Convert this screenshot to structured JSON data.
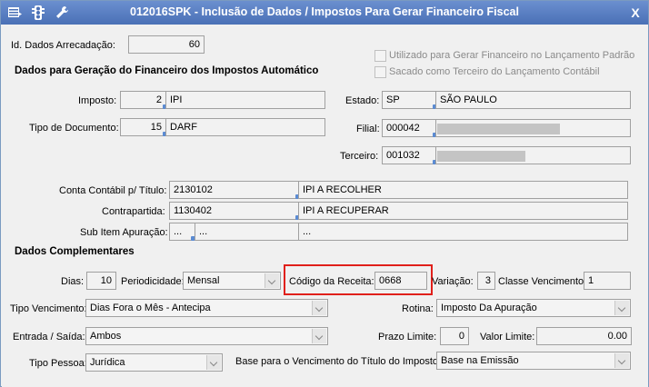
{
  "window": {
    "title": "012016SPK - Inclusão de Dados / Impostos  Para Gerar Financeiro Fiscal",
    "close_label": "X"
  },
  "icons": [
    "grid-icon",
    "traffic-light-icon",
    "wrench-icon"
  ],
  "id_dados": {
    "label": "Id. Dados Arrecadação:",
    "value": "60"
  },
  "checkboxes": {
    "gerar_financeiro": "Utilizado para Gerar Financeiro no Lançamento Padrão",
    "sacado_terceiro": "Sacado como Terceiro do Lançamento Contábil"
  },
  "section_auto": "Dados para Geração do Financeiro dos Impostos Automático",
  "imposto": {
    "label": "Imposto:",
    "code": "2",
    "desc": "IPI"
  },
  "tipo_documento": {
    "label": "Tipo de Documento:",
    "code": "15",
    "desc": "DARF"
  },
  "estado": {
    "label": "Estado:",
    "code": "SP",
    "desc": "SÃO PAULO"
  },
  "filial": {
    "label": "Filial:",
    "code": "000042"
  },
  "terceiro": {
    "label": "Terceiro:",
    "code": "001032"
  },
  "conta_contabil": {
    "label": "Conta Contábil p/ Título:",
    "code": "2130102",
    "desc": "IPI A RECOLHER"
  },
  "contrapartida": {
    "label": "Contrapartida:",
    "code": "1130402",
    "desc": "IPI A RECUPERAR"
  },
  "sub_item": {
    "label": "Sub Item Apuração:",
    "code": "...",
    "mid": "...",
    "desc": "..."
  },
  "section_comp": "Dados Complementares",
  "dias": {
    "label": "Dias:",
    "value": "10"
  },
  "periodicidade": {
    "label": "Periodicidade:",
    "value": "Mensal"
  },
  "codigo_receita": {
    "label": "Código da Receita:",
    "value": "0668"
  },
  "variacao": {
    "label": "Variação:",
    "value": "3"
  },
  "classe_vencimento": {
    "label": "Classe Vencimento:",
    "value": "1"
  },
  "tipo_vencimento": {
    "label": "Tipo Vencimento:",
    "value": "Dias Fora o Mês - Antecipa"
  },
  "rotina": {
    "label": "Rotina:",
    "value": "Imposto Da Apuração"
  },
  "entrada_saida": {
    "label": "Entrada / Saída:",
    "value": "Ambos"
  },
  "prazo_limite": {
    "label": "Prazo Limite:",
    "value": "0"
  },
  "valor_limite": {
    "label": "Valor Limite:",
    "value": "0.00"
  },
  "tipo_pessoa": {
    "label": "Tipo Pessoa:",
    "value": "Jurídica"
  },
  "base_vencimento": {
    "label": "Base para o Vencimento do Título do Imposto:",
    "value": "Base na Emissão"
  },
  "colors": {
    "title_bar": "#5a7fc4",
    "highlight": "#e0201b",
    "lookup_dot": "#5b8bd3"
  }
}
